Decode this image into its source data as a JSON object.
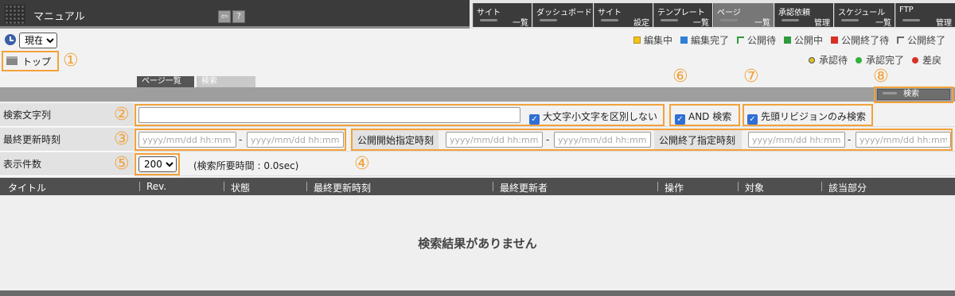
{
  "app": {
    "title": "マニュアル"
  },
  "toolbar": {
    "back_glyph": "⇦",
    "help_glyph": "?"
  },
  "menu": [
    {
      "l1": "サイト",
      "l2": "一覧"
    },
    {
      "l1": "ダッシュボード",
      "l2": ""
    },
    {
      "l1": "サイト",
      "l2": "設定"
    },
    {
      "l1": "テンプレート",
      "l2": "一覧"
    },
    {
      "l1": "ページ",
      "l2": "一覧"
    },
    {
      "l1": "承認依頼",
      "l2": "管理"
    },
    {
      "l1": "スケジュール",
      "l2": "一覧"
    },
    {
      "l1": "FTP",
      "l2": "管理"
    }
  ],
  "time_select": {
    "value": "現在"
  },
  "breadcrumb": {
    "top": "トップ"
  },
  "legend": {
    "editing": "編集中",
    "edit_done": "編集完了",
    "pub_wait": "公開待",
    "publishing": "公開中",
    "pub_end_wait": "公開終了待",
    "pub_ended": "公開終了",
    "approval_wait": "承認待",
    "approval_done": "承認完了",
    "returned": "差戻"
  },
  "colors": {
    "editing": "#f4c21b",
    "edit_done": "#2f7fd8",
    "pub_wait": "#2f9b3a",
    "publishing": "#2f9b3a",
    "pub_end_wait": "#d93025",
    "pub_ended": "#777777",
    "approval_wait": "#e0c020",
    "approval_done": "#2fb33a",
    "returned": "#d93025",
    "callout": "#f2a23a"
  },
  "tabs": {
    "page_list": "ページ一覧",
    "search": "検索"
  },
  "search_button": "検索",
  "callouts": [
    "①",
    "②",
    "③",
    "④",
    "⑤",
    "⑥",
    "⑦",
    "⑧"
  ],
  "rows": {
    "keyword_label": "検索文字列",
    "case_label": "大文字小文字を区別しない",
    "and_label": "AND 検索",
    "head_rev_label": "先頭リビジョンのみ検索",
    "updated_label": "最終更新時刻",
    "pub_start_label": "公開開始指定時刻",
    "pub_end_label": "公開終了指定時刻",
    "date_placeholder": "yyyy/mm/dd hh:mm",
    "range_sep": "-",
    "count_label": "表示件数",
    "count_value": "200",
    "elapsed": "(検索所要時間 : 0.0sec)"
  },
  "table": {
    "headers": [
      "タイトル",
      "Rev.",
      "状態",
      "最終更新時刻",
      "最終更新者",
      "操作",
      "対象",
      "該当部分"
    ],
    "empty_message": "検索結果がありません"
  }
}
